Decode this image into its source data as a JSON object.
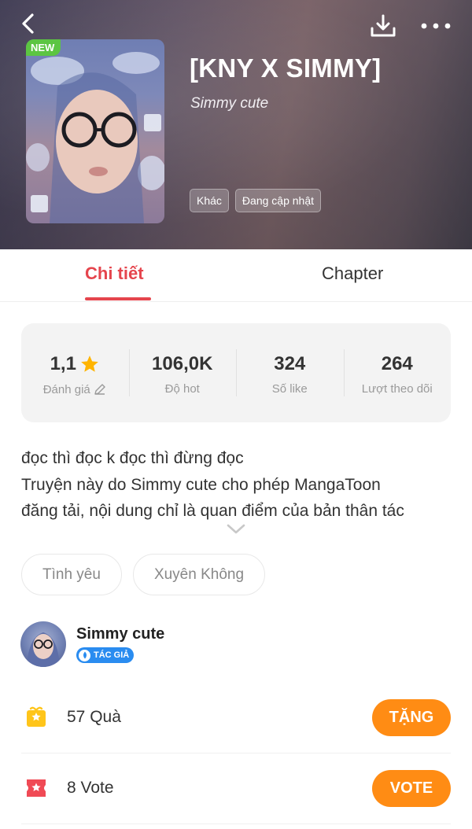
{
  "header": {
    "title": "[KNY X SIMMY]",
    "author": "Simmy cute",
    "cover_badge": "NEW",
    "tags": [
      "Khác",
      "Đang cập nhật"
    ]
  },
  "tabs": [
    {
      "label": "Chi tiết",
      "active": true
    },
    {
      "label": "Chapter",
      "active": false
    }
  ],
  "stats": [
    {
      "value": "1,1",
      "label": "Đánh giá"
    },
    {
      "value": "106,0K",
      "label": "Độ hot"
    },
    {
      "value": "324",
      "label": "Số like"
    },
    {
      "value": "264",
      "label": "Lượt theo dõi"
    }
  ],
  "description": [
    "đọc thì đọc k đọc thì đừng đọc",
    "Truyện này do Simmy cute cho phép MangaToon",
    "đăng tải, nội dung chỉ là quan điểm của bản thân tác"
  ],
  "genres": [
    "Tình yêu",
    "Xuyên Không"
  ],
  "author": {
    "name": "Simmy cute",
    "badge": "TÁC GIẢ"
  },
  "gift": {
    "count": "57",
    "label": "Quà",
    "button": "TẶNG"
  },
  "vote": {
    "count": "8",
    "label": "Vote",
    "button": "VOTE"
  },
  "colors": {
    "accent": "#e5454d",
    "button": "#ff8c14",
    "new_badge": "#5cc542",
    "author_badge": "#2a8cf0",
    "star": "#ffb400"
  }
}
